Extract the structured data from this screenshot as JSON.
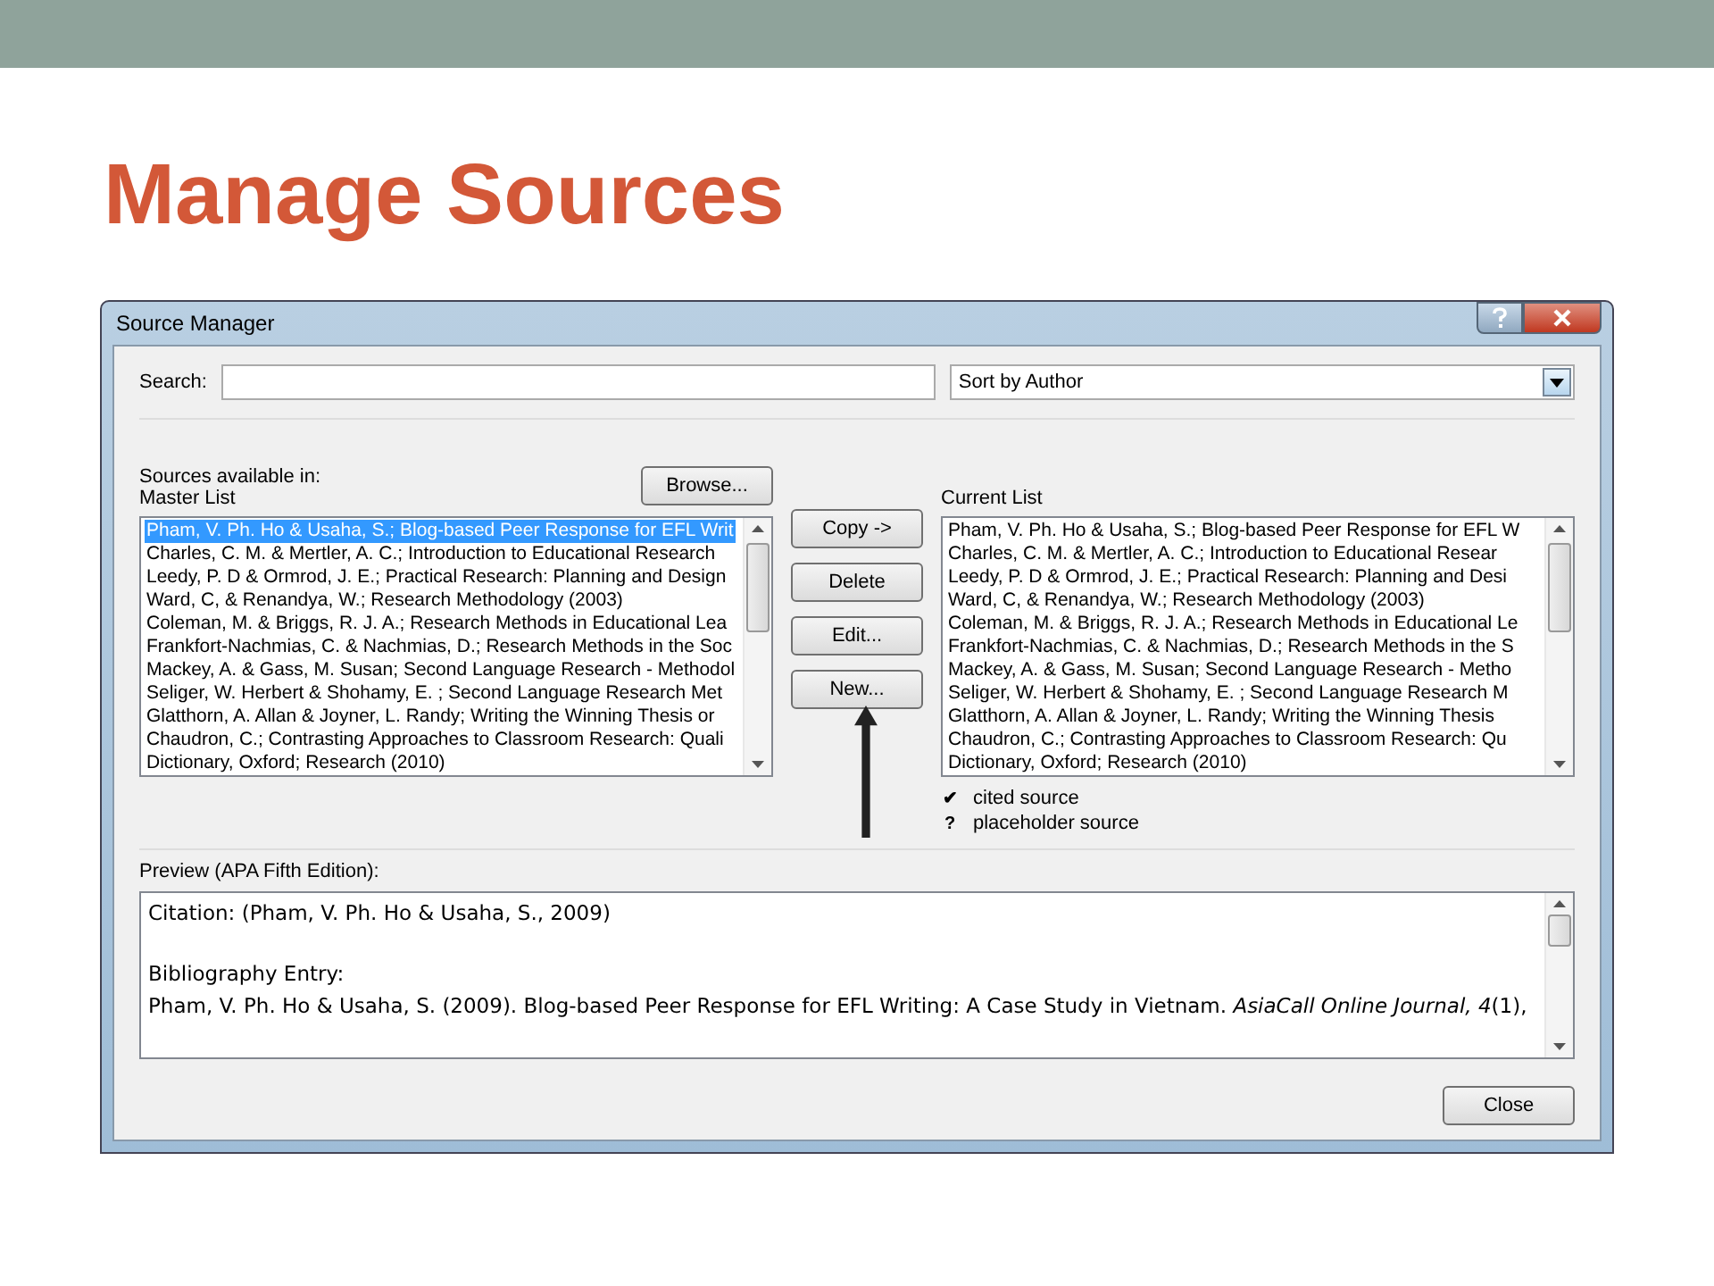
{
  "slide": {
    "title": "Manage Sources"
  },
  "window": {
    "title": "Source Manager"
  },
  "search": {
    "label": "Search:"
  },
  "sort": {
    "value": "Sort by Author"
  },
  "sources_label": "Sources available in:",
  "master_list": {
    "label": "Master List",
    "items": [
      {
        "text": "Pham, V. Ph. Ho & Usaha, S.; Blog-based Peer Response for EFL Writ",
        "selected": true
      },
      {
        "text": "Charles, C. M. & Mertler, A. C.; Introduction to Educational Research",
        "selected": false
      },
      {
        "text": "Leedy, P. D & Ormrod, J. E.; Practical Research: Planning and Design",
        "selected": false
      },
      {
        "text": "Ward, C, & Renandya, W.; Research Methodology (2003)",
        "selected": false
      },
      {
        "text": "Coleman, M. & Briggs, R. J. A.; Research Methods in Educational Lea",
        "selected": false
      },
      {
        "text": "Frankfort-Nachmias, C. & Nachmias, D.; Research Methods in the Soc",
        "selected": false
      },
      {
        "text": "Mackey, A. & Gass, M. Susan; Second Language Research - Methodol",
        "selected": false
      },
      {
        "text": "Seliger, W. Herbert & Shohamy, E. ; Second Language Research Met",
        "selected": false
      },
      {
        "text": "Glatthorn, A. Allan & Joyner, L. Randy; Writing the Winning Thesis or",
        "selected": false
      },
      {
        "text": "Chaudron, C.; Contrasting Approaches to Classroom Research: Quali",
        "selected": false
      },
      {
        "text": "Dictionary, Oxford; Research (2010)",
        "selected": false
      }
    ]
  },
  "browse_button": "Browse...",
  "buttons": [
    "Copy ->",
    "Delete",
    "Edit...",
    "New..."
  ],
  "current_list": {
    "label": "Current List",
    "items": [
      {
        "text": "Pham, V. Ph. Ho & Usaha, S.; Blog-based Peer Response for EFL W",
        "selected": false
      },
      {
        "text": "Charles, C. M. & Mertler, A. C.; Introduction to Educational Resear",
        "selected": false
      },
      {
        "text": "Leedy, P. D & Ormrod, J. E.; Practical Research: Planning and Desi",
        "selected": false
      },
      {
        "text": "Ward, C, & Renandya, W.; Research Methodology (2003)",
        "selected": false
      },
      {
        "text": "Coleman, M. & Briggs, R. J. A.; Research Methods in Educational Le",
        "selected": false
      },
      {
        "text": "Frankfort-Nachmias, C. & Nachmias, D.; Research Methods in the S",
        "selected": false
      },
      {
        "text": "Mackey, A. & Gass, M. Susan; Second Language Research - Metho",
        "selected": false
      },
      {
        "text": "Seliger, W. Herbert & Shohamy, E. ; Second Language Research M",
        "selected": false
      },
      {
        "text": "Glatthorn, A. Allan & Joyner, L. Randy; Writing the Winning Thesis",
        "selected": false
      },
      {
        "text": "Chaudron, C.; Contrasting Approaches to Classroom Research: Qu",
        "selected": false
      },
      {
        "text": "Dictionary, Oxford; Research (2010)",
        "selected": false
      }
    ]
  },
  "legend": [
    {
      "symbol": "✔",
      "text": "cited source"
    },
    {
      "symbol": "?",
      "text": "placeholder source"
    }
  ],
  "preview": {
    "label": "Preview (APA Fifth Edition):",
    "citation": "Citation:  (Pham, V. Ph. Ho & Usaha, S., 2009)",
    "bibliography_heading": "Bibliography Entry:",
    "bibliography": "Pham, V. Ph. Ho & Usaha, S. (2009).  Blog-based Peer Response for EFL Writing: A Case Study in Vietnam. *AsiaCall Online Journal, 4*(1),"
  },
  "close_button": "Close"
}
